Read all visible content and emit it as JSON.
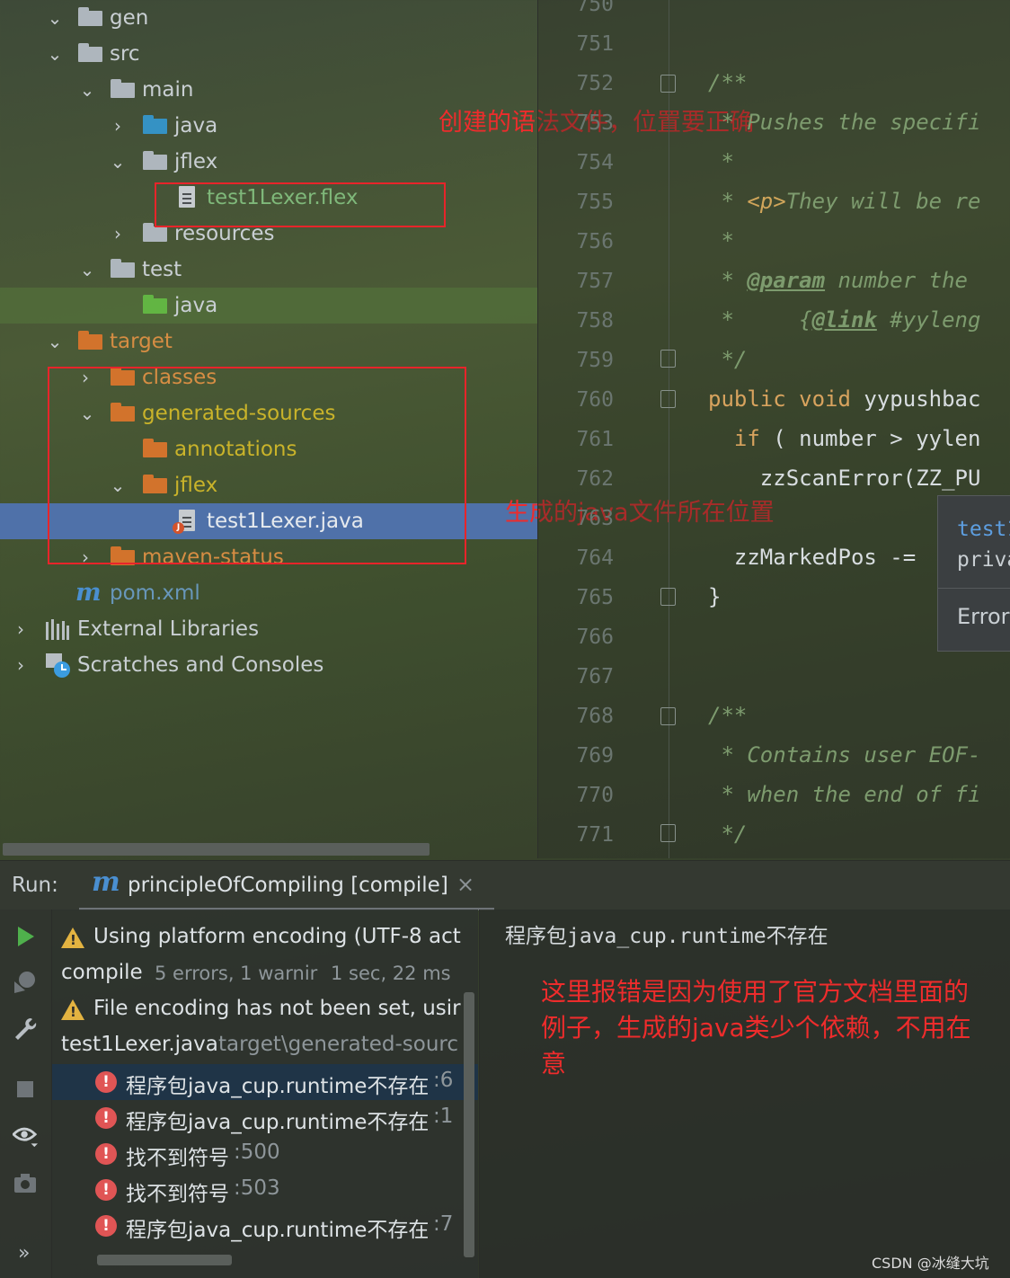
{
  "project_tree": {
    "items": [
      {
        "label": "gen"
      },
      {
        "label": "src"
      },
      {
        "label": "main"
      },
      {
        "label": "java"
      },
      {
        "label": "jflex"
      },
      {
        "label": "test1Lexer.flex"
      },
      {
        "label": "resources"
      },
      {
        "label": "test"
      },
      {
        "label": "java"
      },
      {
        "label": "target"
      },
      {
        "label": "classes"
      },
      {
        "label": "generated-sources"
      },
      {
        "label": "annotations"
      },
      {
        "label": "jflex"
      },
      {
        "label": "test1Lexer.java"
      },
      {
        "label": "maven-status"
      },
      {
        "label": "pom.xml"
      },
      {
        "label": "External Libraries"
      },
      {
        "label": "Scratches and Consoles"
      }
    ]
  },
  "annotations": {
    "flex_note": "创建的语法文件，位置要正确",
    "java_note": "生成的java文件所在位置",
    "error_note": "这里报错是因为使用了官方文档里面的例子，生成的java类少个依赖，不用在意"
  },
  "editor": {
    "line_numbers": [
      "750",
      "751",
      "752",
      "753",
      "754",
      "755",
      "756",
      "757",
      "758",
      "759",
      "760",
      "761",
      "762",
      "763",
      "764",
      "765",
      "766",
      "767",
      "768",
      "769",
      "770",
      "771"
    ],
    "lines": {
      "l752": "/**",
      "l753": " * Pushes the specifi",
      "l754": " *",
      "l755_pre": " * ",
      "l755_tag": "<p>",
      "l755_post": "They will be re",
      "l756": " *",
      "l757_pre": " * ",
      "l757_tag": "@param",
      "l757_post": " number the",
      "l758_pre": " *     {",
      "l758_tag": "@link",
      "l758_post": " #yyleng",
      "l759": " */",
      "l760_kw": "public void ",
      "l760_id": "yypushbac",
      "l761_kw": "  if",
      "l761_id": " ( number > yylen",
      "l762": "    zzScanError(ZZ_PU",
      "l764": "  zzMarkedPos -=",
      "l765": "}",
      "l768": "/**",
      "l769": " * Contains user EOF-",
      "l770": " * when the end of fi",
      "l771": " */"
    },
    "popup": {
      "line1": "test1",
      "line2": "priva",
      "line3": "Error"
    }
  },
  "run": {
    "label": "Run:",
    "tab_label": "principleOfCompiling [compile]",
    "close_glyph": "×",
    "rows": [
      {
        "text": "Using platform encoding (UTF-8 act"
      },
      {
        "text": "compile",
        "detail": "5 errors, 1 warnir",
        "time": "1 sec, 22 ms"
      },
      {
        "text": "File encoding has not been set, usir"
      },
      {
        "text": "test1Lexer.java",
        "detail": "target\\generated-sourc"
      },
      {
        "text": "程序包java_cup.runtime不存在",
        "loc": ":6"
      },
      {
        "text": "程序包java_cup.runtime不存在",
        "loc": ":1"
      },
      {
        "text": "找不到符号",
        "loc": ":500"
      },
      {
        "text": "找不到符号",
        "loc": ":503"
      },
      {
        "text": "程序包java_cup.runtime不存在",
        "loc": ":7"
      }
    ],
    "message_prefix": "程序包",
    "message_code": "java_cup.runtime",
    "message_suffix": "不存在",
    "more_glyph": "»"
  },
  "watermark": "CSDN @冰缝大坑",
  "colors": {
    "annotation": "#e8242a",
    "selection": "#4f71a9",
    "error": "#e05555",
    "warning": "#e3b341"
  }
}
